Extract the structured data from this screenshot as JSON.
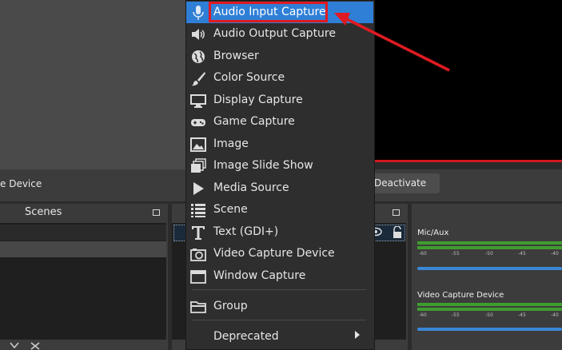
{
  "toolbar": {
    "device_label": "e Device",
    "deactivate_label": "Deactivate"
  },
  "scenes": {
    "title": "Scenes"
  },
  "mixer": {
    "channels": [
      {
        "name": "Mic/Aux"
      },
      {
        "name": "Video Capture Device"
      }
    ],
    "ticks": [
      "-60",
      "-55",
      "-50",
      "-45",
      "-40"
    ]
  },
  "menu": {
    "items": [
      {
        "label": "Audio Input Capture",
        "icon": "microphone-icon",
        "selected": true
      },
      {
        "label": "Audio Output Capture",
        "icon": "speaker-icon"
      },
      {
        "label": "Browser",
        "icon": "globe-icon"
      },
      {
        "label": "Color Source",
        "icon": "brush-icon"
      },
      {
        "label": "Display Capture",
        "icon": "monitor-icon"
      },
      {
        "label": "Game Capture",
        "icon": "gamepad-icon"
      },
      {
        "label": "Image",
        "icon": "image-icon"
      },
      {
        "label": "Image Slide Show",
        "icon": "slideshow-icon"
      },
      {
        "label": "Media Source",
        "icon": "play-icon"
      },
      {
        "label": "Scene",
        "icon": "list-icon"
      },
      {
        "label": "Text (GDI+)",
        "icon": "text-icon"
      },
      {
        "label": "Video Capture Device",
        "icon": "camera-icon"
      },
      {
        "label": "Window Capture",
        "icon": "window-icon"
      },
      {
        "label": "Group",
        "icon": "folder-icon"
      },
      {
        "label": "Deprecated",
        "icon": ""
      }
    ]
  },
  "colors": {
    "selection": "#2f7fd6",
    "annotation": "#e01a22"
  }
}
